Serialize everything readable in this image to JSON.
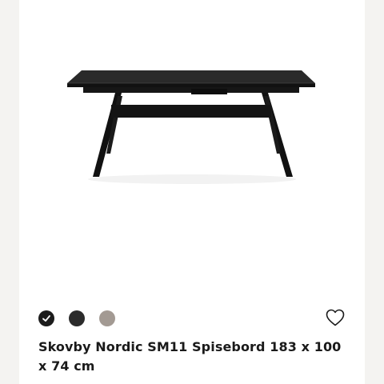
{
  "product": {
    "title": "Skovby Nordic SM11 Spisebord 183 x 100 x 74 cm",
    "image_icon": "dining-table-image",
    "favorite_icon": "heart-outline-icon"
  },
  "swatches": [
    {
      "name": "black-selected",
      "color": "#1c1c1c",
      "selected": true,
      "icon": "checkmark-icon"
    },
    {
      "name": "black-ash",
      "color": "#2b2b2b",
      "selected": false
    },
    {
      "name": "grey-oak",
      "color": "#a39a93",
      "selected": false
    }
  ],
  "colors": {
    "page_background": "#f4f3f1",
    "card_background": "#ffffff",
    "text": "#1a1a1a"
  }
}
